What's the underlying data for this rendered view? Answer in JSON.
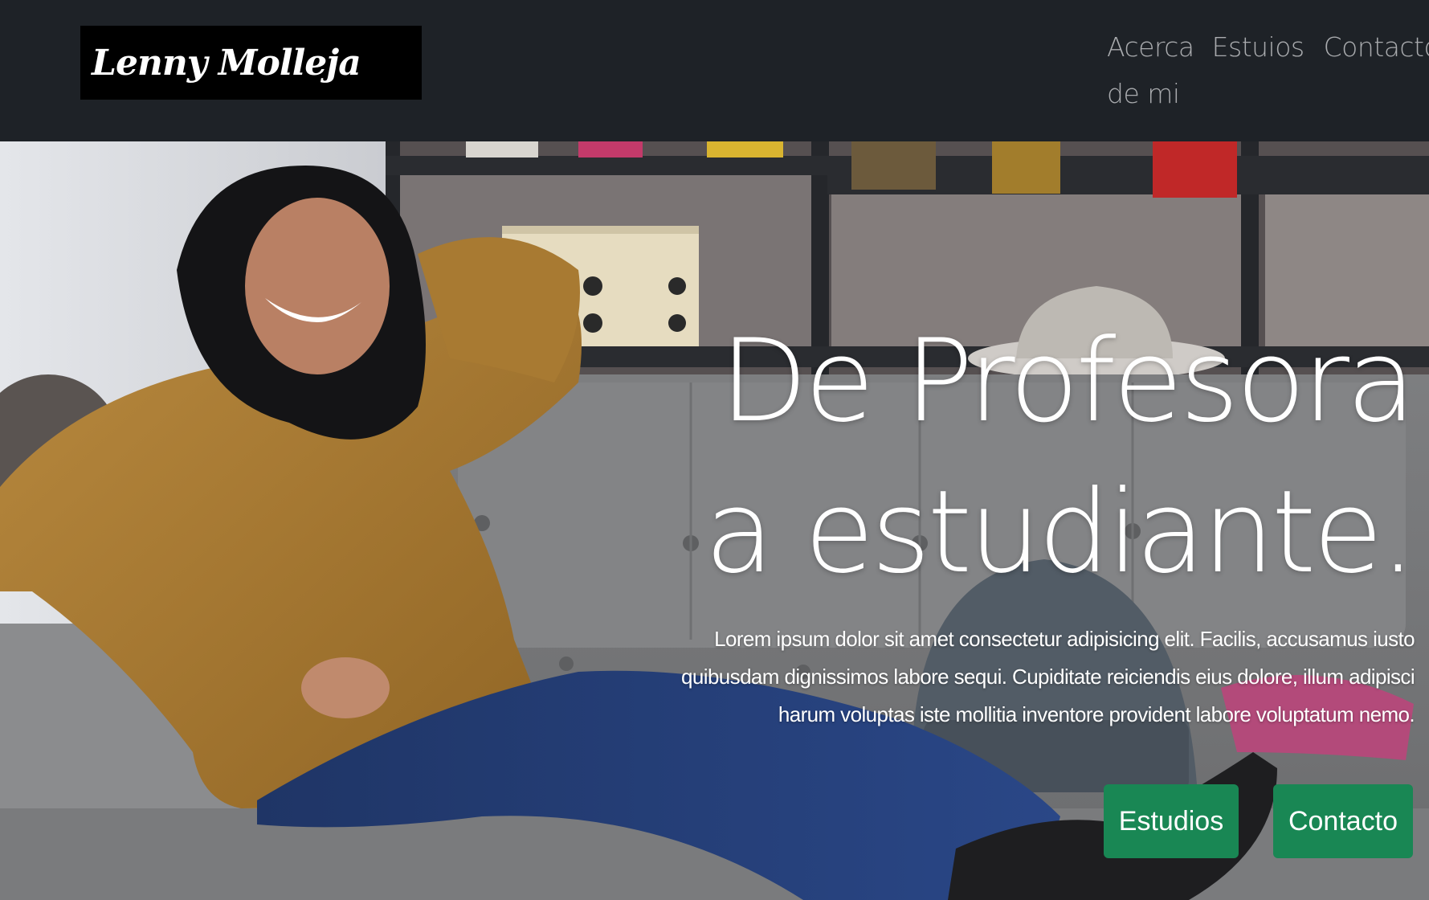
{
  "brand": {
    "name": "Lenny Molleja"
  },
  "nav": {
    "items": [
      {
        "label": "Acerca de mi"
      },
      {
        "label": "Estuios"
      },
      {
        "label": "Contacto"
      }
    ]
  },
  "hero": {
    "title_line1": "De Profesora",
    "title_line2": "a estudiante.",
    "paragraph": "Lorem ipsum dolor sit amet consectetur adipisicing elit. Facilis, accusamus iusto quibusdam dignissimos labore sequi. Cupiditate reiciendis eius dolore, illum adipisci harum voluptas iste mollitia inventore provident labore voluptatum nemo.",
    "buttons": {
      "studies": "Estudios",
      "contact": "Contacto"
    }
  },
  "colors": {
    "navbar_bg": "#1e2227",
    "brand_bg": "#000000",
    "nav_link": "#a9abae",
    "button_bg": "#198754",
    "hero_text": "#ffffff"
  }
}
